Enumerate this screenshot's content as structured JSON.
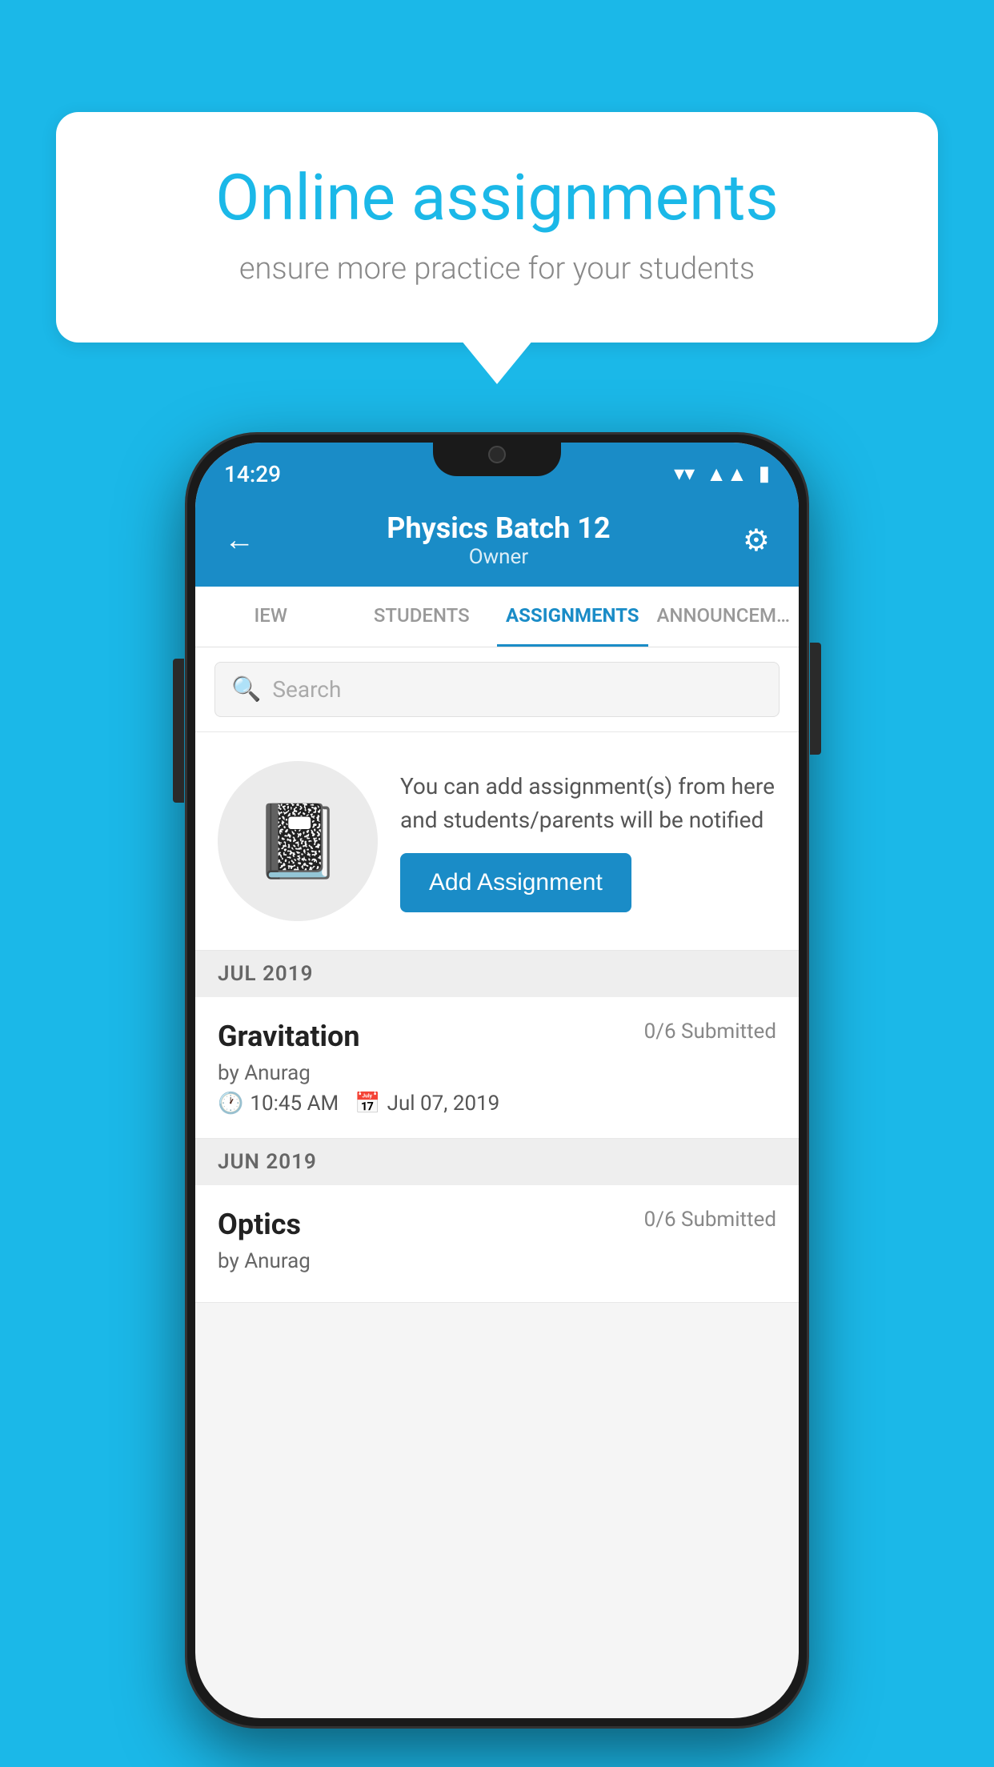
{
  "background_color": "#1bb8e8",
  "speech_bubble": {
    "title": "Online assignments",
    "subtitle": "ensure more practice for your students"
  },
  "status_bar": {
    "time": "14:29",
    "icons": [
      "wifi",
      "signal",
      "battery"
    ]
  },
  "header": {
    "title": "Physics Batch 12",
    "subtitle": "Owner",
    "back_label": "←",
    "gear_label": "⚙"
  },
  "tabs": [
    {
      "label": "IEW",
      "active": false
    },
    {
      "label": "STUDENTS",
      "active": false
    },
    {
      "label": "ASSIGNMENTS",
      "active": true
    },
    {
      "label": "ANNOUNCEM…",
      "active": false
    }
  ],
  "search": {
    "placeholder": "Search"
  },
  "empty_state": {
    "description": "You can add assignment(s) from here and students/parents will be notified",
    "button_label": "Add Assignment"
  },
  "months": [
    {
      "label": "JUL 2019",
      "assignments": [
        {
          "name": "Gravitation",
          "submitted": "0/6 Submitted",
          "by": "by Anurag",
          "time": "10:45 AM",
          "date": "Jul 07, 2019"
        }
      ]
    },
    {
      "label": "JUN 2019",
      "assignments": [
        {
          "name": "Optics",
          "submitted": "0/6 Submitted",
          "by": "by Anurag",
          "time": "",
          "date": ""
        }
      ]
    }
  ]
}
